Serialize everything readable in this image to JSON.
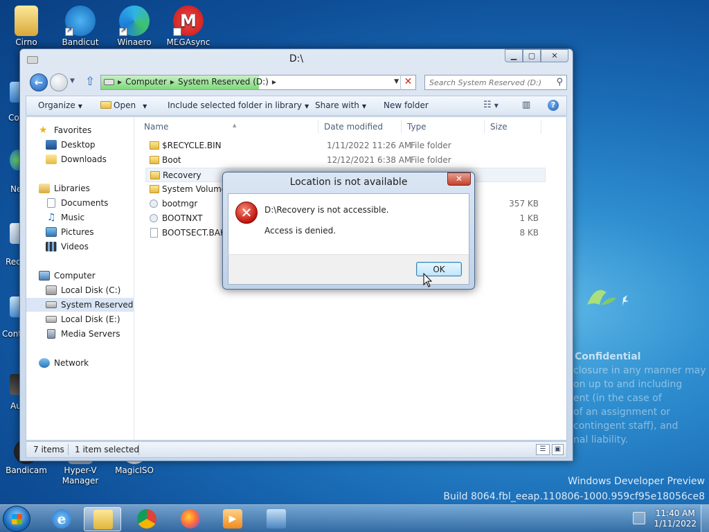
{
  "desktop": {
    "icons": [
      {
        "label": "Cirno"
      },
      {
        "label": "Bandicut"
      },
      {
        "label": "Winaero"
      },
      {
        "label": "MEGAsync"
      },
      {
        "label": "Bandicam"
      },
      {
        "label": "Hyper-V Manager"
      },
      {
        "label": "MagicISO"
      }
    ],
    "left_partial": [
      "Co",
      "Ne",
      "Rec",
      "Cont",
      "Au"
    ],
    "watermark": {
      "title": "Confidential",
      "lines": [
        "closure in any manner may",
        "on up to and including",
        "ent (in the case of",
        "of an assignment or",
        "contingent staff), and",
        "nal liability."
      ]
    },
    "dev_preview": {
      "line1": "Windows Developer Preview",
      "line2": "Build 8064.fbl_eeap.110806-1000.959cf95e18056ce8"
    }
  },
  "explorer": {
    "title": "D:\\",
    "address": {
      "crumbs": [
        "Computer",
        "System Reserved (D:)"
      ]
    },
    "search": {
      "placeholder": "Search System Reserved (D:)"
    },
    "toolbar": {
      "organize": "Organize",
      "open": "Open",
      "include": "Include selected folder in library",
      "share": "Share with",
      "new_folder": "New folder"
    },
    "nav": {
      "favorites": "Favorites",
      "desktop": "Desktop",
      "downloads": "Downloads",
      "libraries": "Libraries",
      "documents": "Documents",
      "music": "Music",
      "pictures": "Pictures",
      "videos": "Videos",
      "computer": "Computer",
      "local_c": "Local Disk (C:)",
      "system_d": "System Reserved (D:)",
      "local_e": "Local Disk (E:)",
      "media": "Media Servers",
      "network": "Network"
    },
    "columns": {
      "name": "Name",
      "date": "Date modified",
      "type": "Type",
      "size": "Size"
    },
    "files": [
      {
        "name": "$RECYCLE.BIN",
        "date": "1/11/2022 11:26 AM",
        "type": "File folder",
        "size": ""
      },
      {
        "name": "Boot",
        "date": "12/12/2021 6:38 AM",
        "type": "File folder",
        "size": ""
      },
      {
        "name": "Recovery",
        "date": "",
        "type": "",
        "size": ""
      },
      {
        "name": "System Volume I",
        "date": "",
        "type": "",
        "size": ""
      },
      {
        "name": "bootmgr",
        "date": "",
        "type": "",
        "size": "357 KB"
      },
      {
        "name": "BOOTNXT",
        "date": "",
        "type": "",
        "size": "1 KB"
      },
      {
        "name": "BOOTSECT.BAK",
        "date": "",
        "type": "",
        "size": "8 KB"
      }
    ],
    "status": {
      "count": "7 items",
      "selected": "1 item selected"
    }
  },
  "dialog": {
    "title": "Location is not available",
    "message1": "D:\\Recovery is not accessible.",
    "message2": "Access is denied.",
    "ok": "OK",
    "close": "✕"
  },
  "taskbar": {
    "time": "11:40 AM",
    "date": "1/11/2022"
  },
  "colors": {
    "accent": "#1c5fb5",
    "error": "#c0140c",
    "address_fill": "#7fd97a"
  }
}
